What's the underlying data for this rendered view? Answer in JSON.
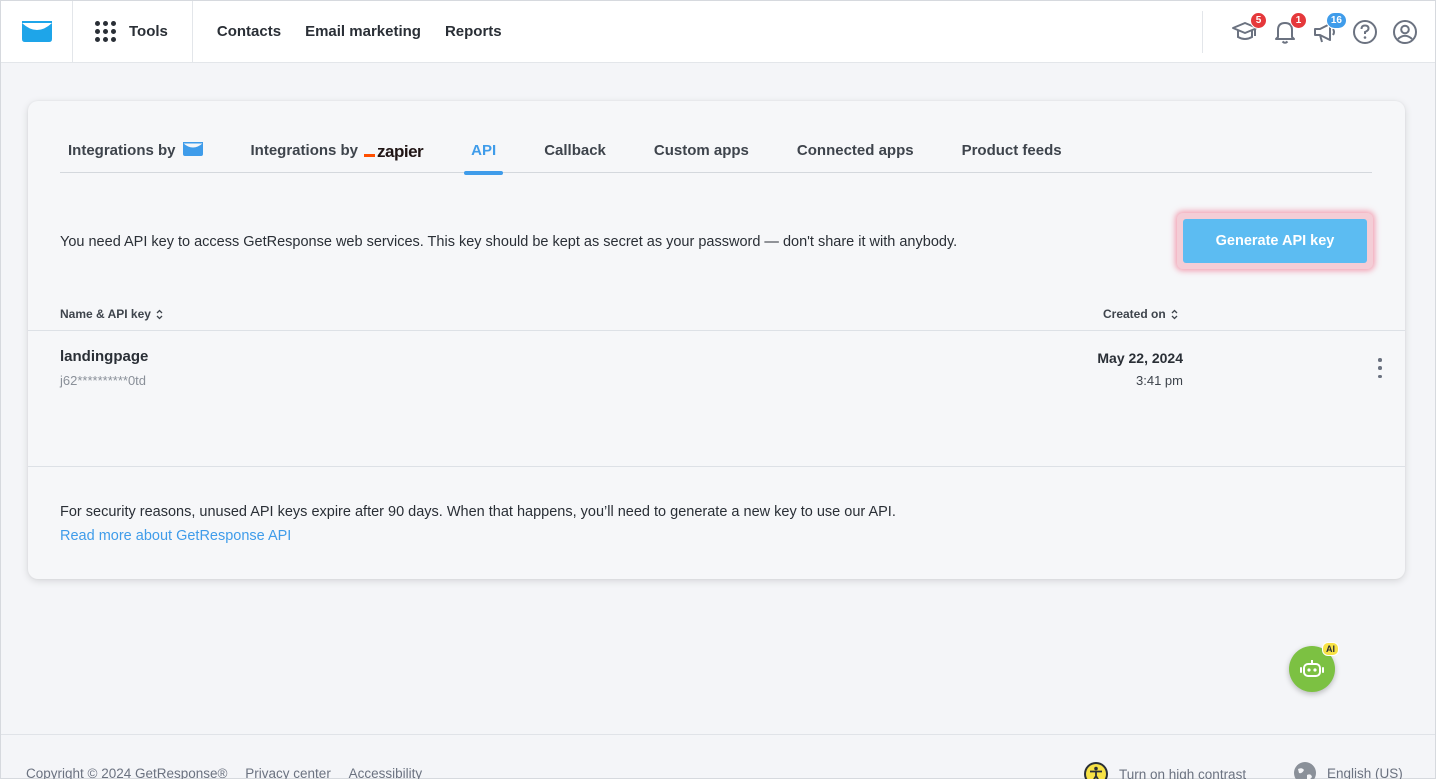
{
  "header": {
    "tools_label": "Tools",
    "nav": [
      "Contacts",
      "Email marketing",
      "Reports"
    ],
    "badges": {
      "academy": "5",
      "notifications": "1",
      "announcements": "16"
    }
  },
  "tabs": [
    {
      "label": "Integrations by",
      "active": false
    },
    {
      "label": "Integrations by",
      "active": false
    },
    {
      "label": "API",
      "active": true
    },
    {
      "label": "Callback",
      "active": false
    },
    {
      "label": "Custom apps",
      "active": false
    },
    {
      "label": "Connected apps",
      "active": false
    },
    {
      "label": "Product feeds",
      "active": false
    }
  ],
  "zapier_logo_text": "zapier",
  "api": {
    "info": "You need API key to access GetResponse web services. This key should be kept as secret as your password — don't share it with anybody.",
    "generate_button": "Generate API key",
    "columns": {
      "name": "Name & API key",
      "created": "Created on"
    },
    "rows": [
      {
        "name": "landingpage",
        "key": "j62**********0td",
        "date": "May 22, 2024",
        "time": "3:41 pm"
      }
    ],
    "security_note": "For security reasons, unused API keys expire after 90 days. When that happens, you’ll need to generate a new key to use our API.",
    "read_more": "Read more about GetResponse API"
  },
  "ai_badge": "AI",
  "footer": {
    "copyright": "Copyright © 2024 GetResponse®",
    "privacy": "Privacy center",
    "accessibility": "Accessibility",
    "high_contrast": "Turn on high contrast",
    "language": "English (US)"
  },
  "colors": {
    "accent": "#3f9cea",
    "button": "#5cbcf2",
    "badge_red": "#e5383b",
    "ai_green": "#7cc142"
  }
}
